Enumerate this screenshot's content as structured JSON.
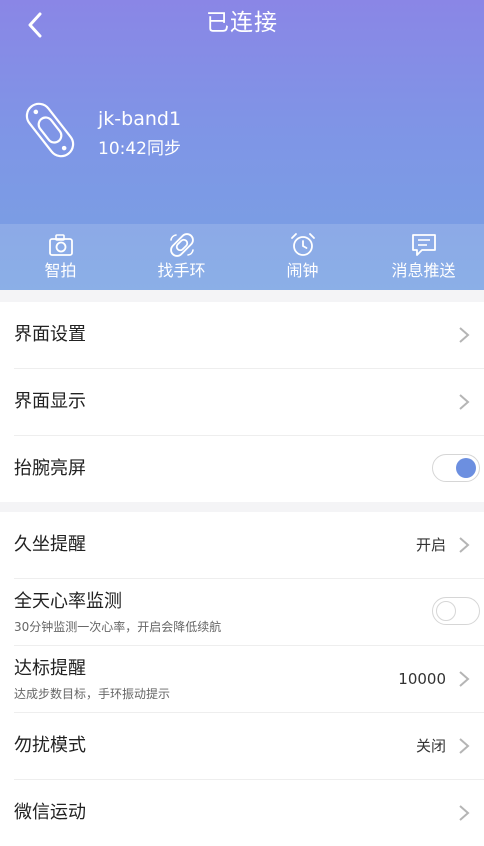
{
  "header": {
    "title": "已连接",
    "device_name": "jk-band1",
    "sync_status": "10:42同步"
  },
  "quick_actions": [
    {
      "label": "智拍",
      "icon": "camera-icon"
    },
    {
      "label": "找手环",
      "icon": "band-search-icon"
    },
    {
      "label": "闹钟",
      "icon": "alarm-clock-icon"
    },
    {
      "label": "消息推送",
      "icon": "message-icon"
    }
  ],
  "settings_group1": [
    {
      "label": "界面设置",
      "control": "chevron"
    },
    {
      "label": "界面显示",
      "control": "chevron"
    },
    {
      "label": "抬腕亮屏",
      "control": "toggle",
      "enabled": true
    }
  ],
  "settings_group2": [
    {
      "label": "久坐提醒",
      "value": "开启",
      "control": "chevron"
    },
    {
      "label": "全天心率监测",
      "sublabel": "30分钟监测一次心率，开启会降低续航",
      "control": "toggle",
      "enabled": false
    },
    {
      "label": "达标提醒",
      "sublabel": "达成步数目标，手环振动提示",
      "value": "10000",
      "control": "chevron"
    },
    {
      "label": "勿扰模式",
      "value": "关闭",
      "control": "chevron"
    },
    {
      "label": "微信运动",
      "control": "chevron"
    }
  ],
  "colors": {
    "header_gradient_top": "#8a86e6",
    "header_gradient_bottom": "#78a2e3",
    "toggle_on": "#6c8fe0"
  }
}
